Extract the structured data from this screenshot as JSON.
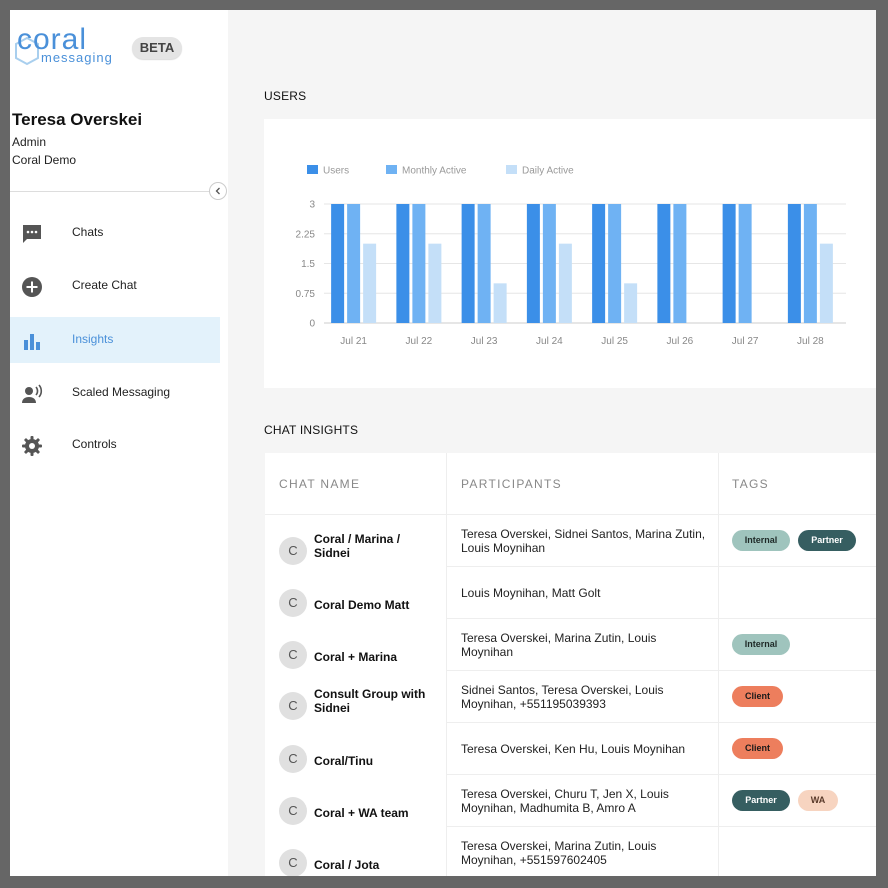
{
  "brand": {
    "word": "coral",
    "sub": "messaging",
    "beta": "BETA",
    "color": "#4a90d9"
  },
  "user": {
    "name": "Teresa Overskei",
    "role": "Admin",
    "org": "Coral Demo"
  },
  "nav": [
    {
      "label": "Chats",
      "icon": "chat-bubble-icon"
    },
    {
      "label": "Create Chat",
      "icon": "plus-circle-icon"
    },
    {
      "label": "Insights",
      "icon": "bar-chart-icon",
      "active": true
    },
    {
      "label": "Scaled Messaging",
      "icon": "broadcast-person-icon"
    },
    {
      "label": "Controls",
      "icon": "gear-icon"
    }
  ],
  "users_section": {
    "title": "USERS"
  },
  "chart_data": {
    "type": "bar",
    "categories": [
      "Jul 21",
      "Jul 22",
      "Jul 23",
      "Jul 24",
      "Jul 25",
      "Jul 26",
      "Jul 27",
      "Jul 28"
    ],
    "series": [
      {
        "name": "Users",
        "color": "#3b8fe8",
        "values": [
          3,
          3,
          3,
          3,
          3,
          3,
          3,
          3
        ]
      },
      {
        "name": "Monthly Active",
        "color": "#6fb2f3",
        "values": [
          3,
          3,
          3,
          3,
          3,
          3,
          3,
          3
        ]
      },
      {
        "name": "Daily Active",
        "color": "#c4dff8",
        "values": [
          2,
          2,
          1,
          2,
          1,
          0,
          0,
          2
        ]
      }
    ],
    "yticks": [
      "0",
      "0.75",
      "1.5",
      "2.25",
      "3"
    ],
    "ylim": [
      0,
      3
    ],
    "grid": true,
    "legend": "top-left"
  },
  "insights": {
    "title": "CHAT INSIGHTS",
    "headers": {
      "name": "CHAT NAME",
      "participants": "PARTICIPANTS",
      "tags": "TAGS"
    },
    "rows": [
      {
        "initial": "C",
        "name": "Coral / Marina / Sidnei",
        "participants": "Teresa Overskei, Sidnei Santos, Marina Zutin, Louis Moynihan",
        "tags": [
          "Internal",
          "Partner"
        ]
      },
      {
        "initial": "C",
        "name": "Coral Demo Matt",
        "participants": "Louis Moynihan, Matt Golt",
        "tags": []
      },
      {
        "initial": "C",
        "name": "Coral + Marina",
        "participants": "Teresa Overskei, Marina Zutin, Louis Moynihan",
        "tags": [
          "Internal"
        ]
      },
      {
        "initial": "C",
        "name": "Consult Group with Sidnei",
        "participants": "Sidnei Santos, Teresa Overskei, Louis Moynihan, +551195039393",
        "tags": [
          "Client"
        ]
      },
      {
        "initial": "C",
        "name": "Coral/Tinu",
        "participants": "Teresa Overskei, Ken Hu, Louis Moynihan",
        "tags": [
          "Client"
        ]
      },
      {
        "initial": "C",
        "name": "Coral + WA team",
        "participants": "Teresa Overskei, Churu T, Jen X, Louis Moynihan, Madhumita B, Amro A",
        "tags": [
          "Partner",
          "WA"
        ]
      },
      {
        "initial": "C",
        "name": "Coral / Jota",
        "participants": "Teresa Overskei, Marina Zutin, Louis Moynihan, +551597602405",
        "tags": []
      }
    ],
    "tag_styles": {
      "Internal": {
        "bg": "#9fc4bd",
        "fg": "#1f2a28"
      },
      "Partner": {
        "bg": "#365e61",
        "fg": "#ffffff"
      },
      "Client": {
        "bg": "#ed7e5d",
        "fg": "#1a1a1a"
      },
      "WA": {
        "bg": "#f7d4c0",
        "fg": "#5a3a2a"
      }
    }
  }
}
